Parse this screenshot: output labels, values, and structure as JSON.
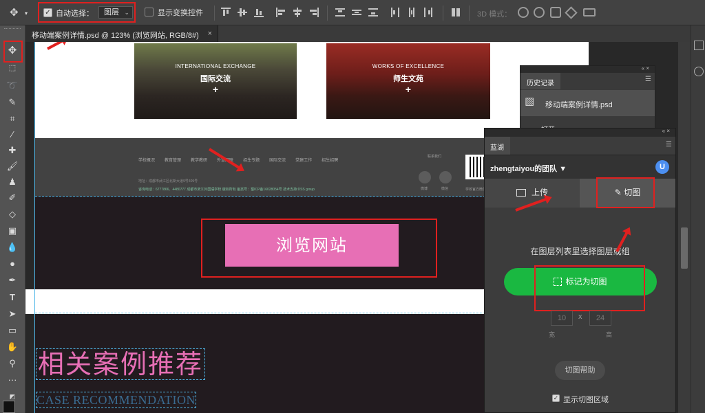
{
  "options_bar": {
    "auto_select_label": "自动选择：",
    "auto_select_checked": true,
    "layer_select_value": "图层",
    "show_transform_label": "显示变换控件",
    "mode3d_label": "3D 模式："
  },
  "document_tab": {
    "title": "移动端案例详情.psd @ 123% (浏览网站, RGB/8#)",
    "close": "×"
  },
  "canvas": {
    "photo1": {
      "caption_en": "INTERNATIONAL EXCHANGE",
      "caption_zh": "国际交流",
      "plus": "+"
    },
    "photo2": {
      "caption_en": "WORKS OF EXCELLENCE",
      "caption_zh": "师生文苑",
      "plus": "+"
    },
    "footer": {
      "nav": [
        "学校概况",
        "教育管理",
        "教学教研",
        "外宣网联",
        "招生专题",
        "国际交流",
        "党建工作",
        "招生招聘"
      ],
      "contact": "联系我们",
      "line1": "地址：成都市武江区北新大道9号309号",
      "line2": "咨询电话：6777866、4480777 成都市武江外国语学校 版权所有  备案号：蜀ICP备16028054号  技术支持:DSS group",
      "social1": "微博",
      "social2": "微信",
      "qr_label": "学校官方微信账号"
    },
    "browse_button": "浏览网站",
    "recommend_zh": "相关案例推荐",
    "recommend_en": "CASE RECOMMENDATION"
  },
  "history_panel": {
    "controls": "« ×",
    "tab_label": "历史记录",
    "item_label": "移动端案例详情.psd",
    "sub_label": "打开"
  },
  "lanhu_panel": {
    "controls": "« ×",
    "tab_label": "蓝湖",
    "team_name": "zhengtaiyou的团队",
    "avatar_letter": "U",
    "upload_tab": "上传",
    "slice_tab": "切图",
    "hint": "在图层列表里选择图层或组",
    "mark_button": "标记为切图",
    "width_value": "10",
    "height_value": "24",
    "times": "x",
    "width_label": "宽",
    "height_label": "高",
    "help_button": "切图帮助",
    "show_area_label": "显示切图区域",
    "show_area_checked": true
  },
  "colors": {
    "accent_pink": "#e76fb5",
    "annotation_red": "#e0201f",
    "lanhu_green": "#1ab841",
    "guide_blue": "#4fb7e8"
  }
}
